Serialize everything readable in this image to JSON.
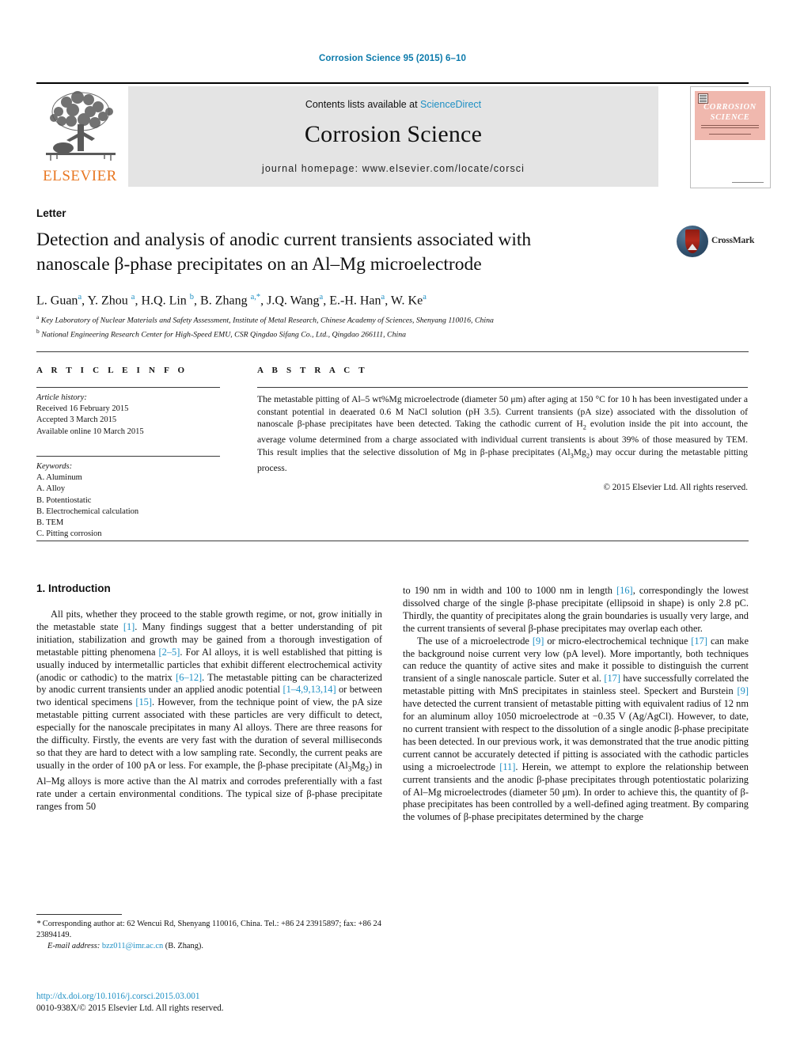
{
  "running_head": "Corrosion Science 95 (2015) 6–10",
  "masthead": {
    "contents_prefix": "Contents lists available at ",
    "sciencedirect": "ScienceDirect",
    "journal_title": "Corrosion Science",
    "homepage": "journal homepage: www.elsevier.com/locate/corsci",
    "publisher_logo_text": "ELSEVIER",
    "cover": {
      "line1": "CORROSION",
      "line2": "SCIENCE"
    },
    "colors": {
      "link": "#1d8fc4",
      "band": "#e4e4e4",
      "elsevier_orange": "#e87722",
      "cover_pink": "#f0b8ae"
    }
  },
  "article": {
    "doctype": "Letter",
    "title": "Detection and analysis of anodic current transients associated with nanoscale β-phase precipitates on an Al–Mg microelectrode",
    "crossmark_label": "CrossMark",
    "authors_html": "L. Guan<sup>a</sup>, Y. Zhou <sup>a</sup>, H.Q. Lin <sup>b</sup>, B. Zhang <sup>a,</sup><sup>*</sup>, J.Q. Wang<sup>a</sup>, E.-H. Han<sup>a</sup>, W. Ke<sup>a</sup>",
    "affiliation_a": "Key Laboratory of Nuclear Materials and Safety Assessment, Institute of Metal Research, Chinese Academy of Sciences, Shenyang 110016, China",
    "affiliation_b": "National Engineering Research Center for High-Speed EMU, CSR Qingdao Sifang Co., Ltd., Qingdao 266111, China"
  },
  "info": {
    "article_info_head": "A R T I C L E    I N F O",
    "abstract_head": "A B S T R A C T",
    "history_label": "Article history:",
    "history": [
      "Received 16 February 2015",
      "Accepted 3 March 2015",
      "Available online 10 March 2015"
    ],
    "keywords_label": "Keywords:",
    "keywords": [
      "A. Aluminum",
      "A. Alloy",
      "B. Potentiostatic",
      "B. Electrochemical calculation",
      "B. TEM",
      "C. Pitting corrosion"
    ]
  },
  "abstract": {
    "text_html": "The metastable pitting of Al–5 wt%Mg microelectrode (diameter 50 μm) after aging at 150 °C for 10 h has been investigated under a constant potential in deaerated 0.6 M NaCl solution (pH 3.5). Current transients (pA size) associated with the dissolution of nanoscale β-phase precipitates have been detected. Taking the cathodic current of H<sub>2</sub> evolution inside the pit into account, the average volume determined from a charge associated with individual current transients is about 39% of those measured by TEM. This result implies that the selective dissolution of Mg in β-phase precipitates (Al<sub>3</sub>Mg<sub>2</sub>) may occur during the metastable pitting process.",
    "copyright": "© 2015 Elsevier Ltd. All rights reserved."
  },
  "body": {
    "section_title": "1. Introduction",
    "left_paragraph_html": "All pits, whether they proceed to the stable growth regime, or not, grow initially in the metastable state <span class=\"ref\">[1]</span>. Many findings suggest that a better understanding of pit initiation, stabilization and growth may be gained from a thorough investigation of metastable pitting phenomena <span class=\"ref\">[2–5]</span>. For Al alloys, it is well established that pitting is usually induced by intermetallic particles that exhibit different electrochemical activity (anodic or cathodic) to the matrix <span class=\"ref\">[6–12]</span>. The metastable pitting can be characterized by anodic current transients under an applied anodic potential <span class=\"ref\">[1–4,9,13,14]</span> or between two identical specimens <span class=\"ref\">[15]</span>. However, from the technique point of view, the pA size metastable pitting current associated with these particles are very difficult to detect, especially for the nanoscale precipitates in many Al alloys. There are three reasons for the difficulty. Firstly, the events are very fast with the duration of several milliseconds so that they are hard to detect with a low sampling rate. Secondly, the current peaks are usually in the order of 100 pA or less. For example, the β-phase precipitate (Al<sub>3</sub>Mg<sub>2</sub>) in Al–Mg alloys is more active than the Al matrix and corrodes preferentially with a fast rate under a certain environmental conditions. The typical size of β-phase precipitate ranges from 50",
    "right_paragraph_1_html": "to 190 nm in width and 100 to 1000 nm in length <span class=\"ref\">[16]</span>, correspondingly the lowest dissolved charge of the single β-phase precipitate (ellipsoid in shape) is only 2.8 pC. Thirdly, the quantity of precipitates along the grain boundaries is usually very large, and the current transients of several β-phase precipitates may overlap each other.",
    "right_paragraph_2_html": "The use of a microelectrode <span class=\"ref\">[9]</span> or micro-electrochemical technique <span class=\"ref\">[17]</span> can make the background noise current very low (pA level). More importantly, both techniques can reduce the quantity of active sites and make it possible to distinguish the current transient of a single nanoscale particle. Suter et al. <span class=\"ref\">[17]</span> have successfully correlated the metastable pitting with MnS precipitates in stainless steel. Speckert and Burstein <span class=\"ref\">[9]</span> have detected the current transient of metastable pitting with equivalent radius of 12 nm for an aluminum alloy 1050 microelectrode at −0.35 V (Ag/AgCl). However, to date, no current transient with respect to the dissolution of a single anodic β-phase precipitate has been detected. In our previous work, it was demonstrated that the true anodic pitting current cannot be accurately detected if pitting is associated with the cathodic particles using a microelectrode <span class=\"ref\">[11]</span>. Herein, we attempt to explore the relationship between current transients and the anodic β-phase precipitates through potentiostatic polarizing of Al–Mg microelectrodes (diameter 50 μm). In order to achieve this, the quantity of β-phase precipitates has been controlled by a well-defined aging treatment. By comparing the volumes of β-phase precipitates determined by the charge"
  },
  "footer": {
    "corresponding_html": "<span class=\"em\">*</span> Corresponding author at: 62 Wencui Rd, Shenyang 110016, China. Tel.: +86 24 23915897; fax: +86 24 23894149.",
    "email_label": "E-mail address:",
    "email": "bzz011@imr.ac.cn",
    "email_suffix": "(B. Zhang).",
    "doi": "http://dx.doi.org/10.1016/j.corsci.2015.03.001",
    "issn_line": "0010-938X/© 2015 Elsevier Ltd. All rights reserved."
  }
}
